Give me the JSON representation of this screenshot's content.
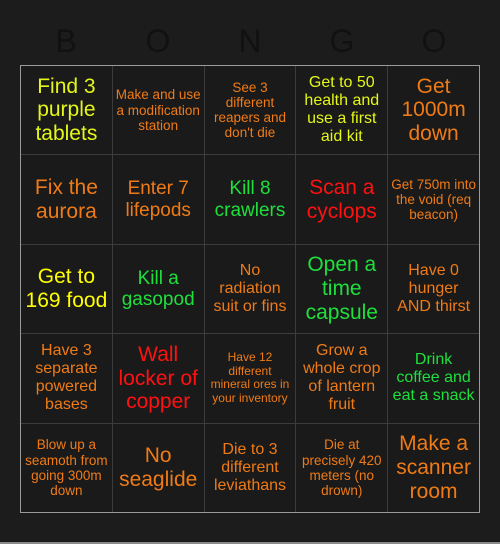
{
  "header": {
    "letters": [
      "B",
      "O",
      "N",
      "G",
      "O"
    ],
    "letter_color": "#111111"
  },
  "board": {
    "background_color": "#1c1c1c",
    "cell_background_color": "#1a1a1a",
    "grid_line_color": "#3c3c3c",
    "outer_border_color": "#9a9a9a",
    "rows": 5,
    "columns": 5,
    "palette": {
      "orange": "#ef7b17",
      "green": "#1ee03c",
      "yellow": "#ffff00",
      "yellow_green": "#e4f718",
      "red": "#ff1111"
    },
    "cells": [
      {
        "text": "Find 3 purple tablets",
        "color": "#e4f718",
        "size": "fs-xl"
      },
      {
        "text": "Make and use a modification station",
        "color": "#ef7b17",
        "size": "fs-sm"
      },
      {
        "text": "See 3 different reapers and don't die",
        "color": "#ef7b17",
        "size": "fs-sm"
      },
      {
        "text": "Get to 50 health and use a first aid kit",
        "color": "#e4f718",
        "size": "fs-md"
      },
      {
        "text": "Get 1000m down",
        "color": "#ef7b17",
        "size": "fs-xl"
      },
      {
        "text": "Fix the aurora",
        "color": "#ef7b17",
        "size": "fs-xl"
      },
      {
        "text": "Enter 7 lifepods",
        "color": "#ef7b17",
        "size": "fs-lg"
      },
      {
        "text": "Kill 8 crawlers",
        "color": "#1ee03c",
        "size": "fs-lg"
      },
      {
        "text": "Scan a cyclops",
        "color": "#ff1111",
        "size": "fs-xl"
      },
      {
        "text": "Get 750m into the void (req beacon)",
        "color": "#ef7b17",
        "size": "fs-sm"
      },
      {
        "text": "Get to 169 food",
        "color": "#ffff00",
        "size": "fs-xl"
      },
      {
        "text": "Kill a gasopod",
        "color": "#1ee03c",
        "size": "fs-lg"
      },
      {
        "text": "No radiation suit or fins",
        "color": "#ef7b17",
        "size": "fs-md"
      },
      {
        "text": "Open a time capsule",
        "color": "#1ee03c",
        "size": "fs-xl"
      },
      {
        "text": "Have 0 hunger AND thirst",
        "color": "#ef7b17",
        "size": "fs-md"
      },
      {
        "text": "Have 3 separate powered bases",
        "color": "#ef7b17",
        "size": "fs-md"
      },
      {
        "text": "Wall locker of copper",
        "color": "#ff1111",
        "size": "fs-xl"
      },
      {
        "text": "Have 12 different mineral ores in your inventory",
        "color": "#ef7b17",
        "size": "fs-xs"
      },
      {
        "text": "Grow a whole crop of lantern fruit",
        "color": "#ef7b17",
        "size": "fs-md"
      },
      {
        "text": "Drink coffee and eat a snack",
        "color": "#1ee03c",
        "size": "fs-md"
      },
      {
        "text": "Blow up a seamoth from going 300m down",
        "color": "#ef7b17",
        "size": "fs-sm"
      },
      {
        "text": "No seaglide",
        "color": "#ef7b17",
        "size": "fs-xl"
      },
      {
        "text": "Die to 3 different leviathans",
        "color": "#ef7b17",
        "size": "fs-md"
      },
      {
        "text": "Die at precisely 420 meters (no drown)",
        "color": "#ef7b17",
        "size": "fs-sm"
      },
      {
        "text": "Make a scanner room",
        "color": "#ef7b17",
        "size": "fs-xl"
      }
    ]
  }
}
